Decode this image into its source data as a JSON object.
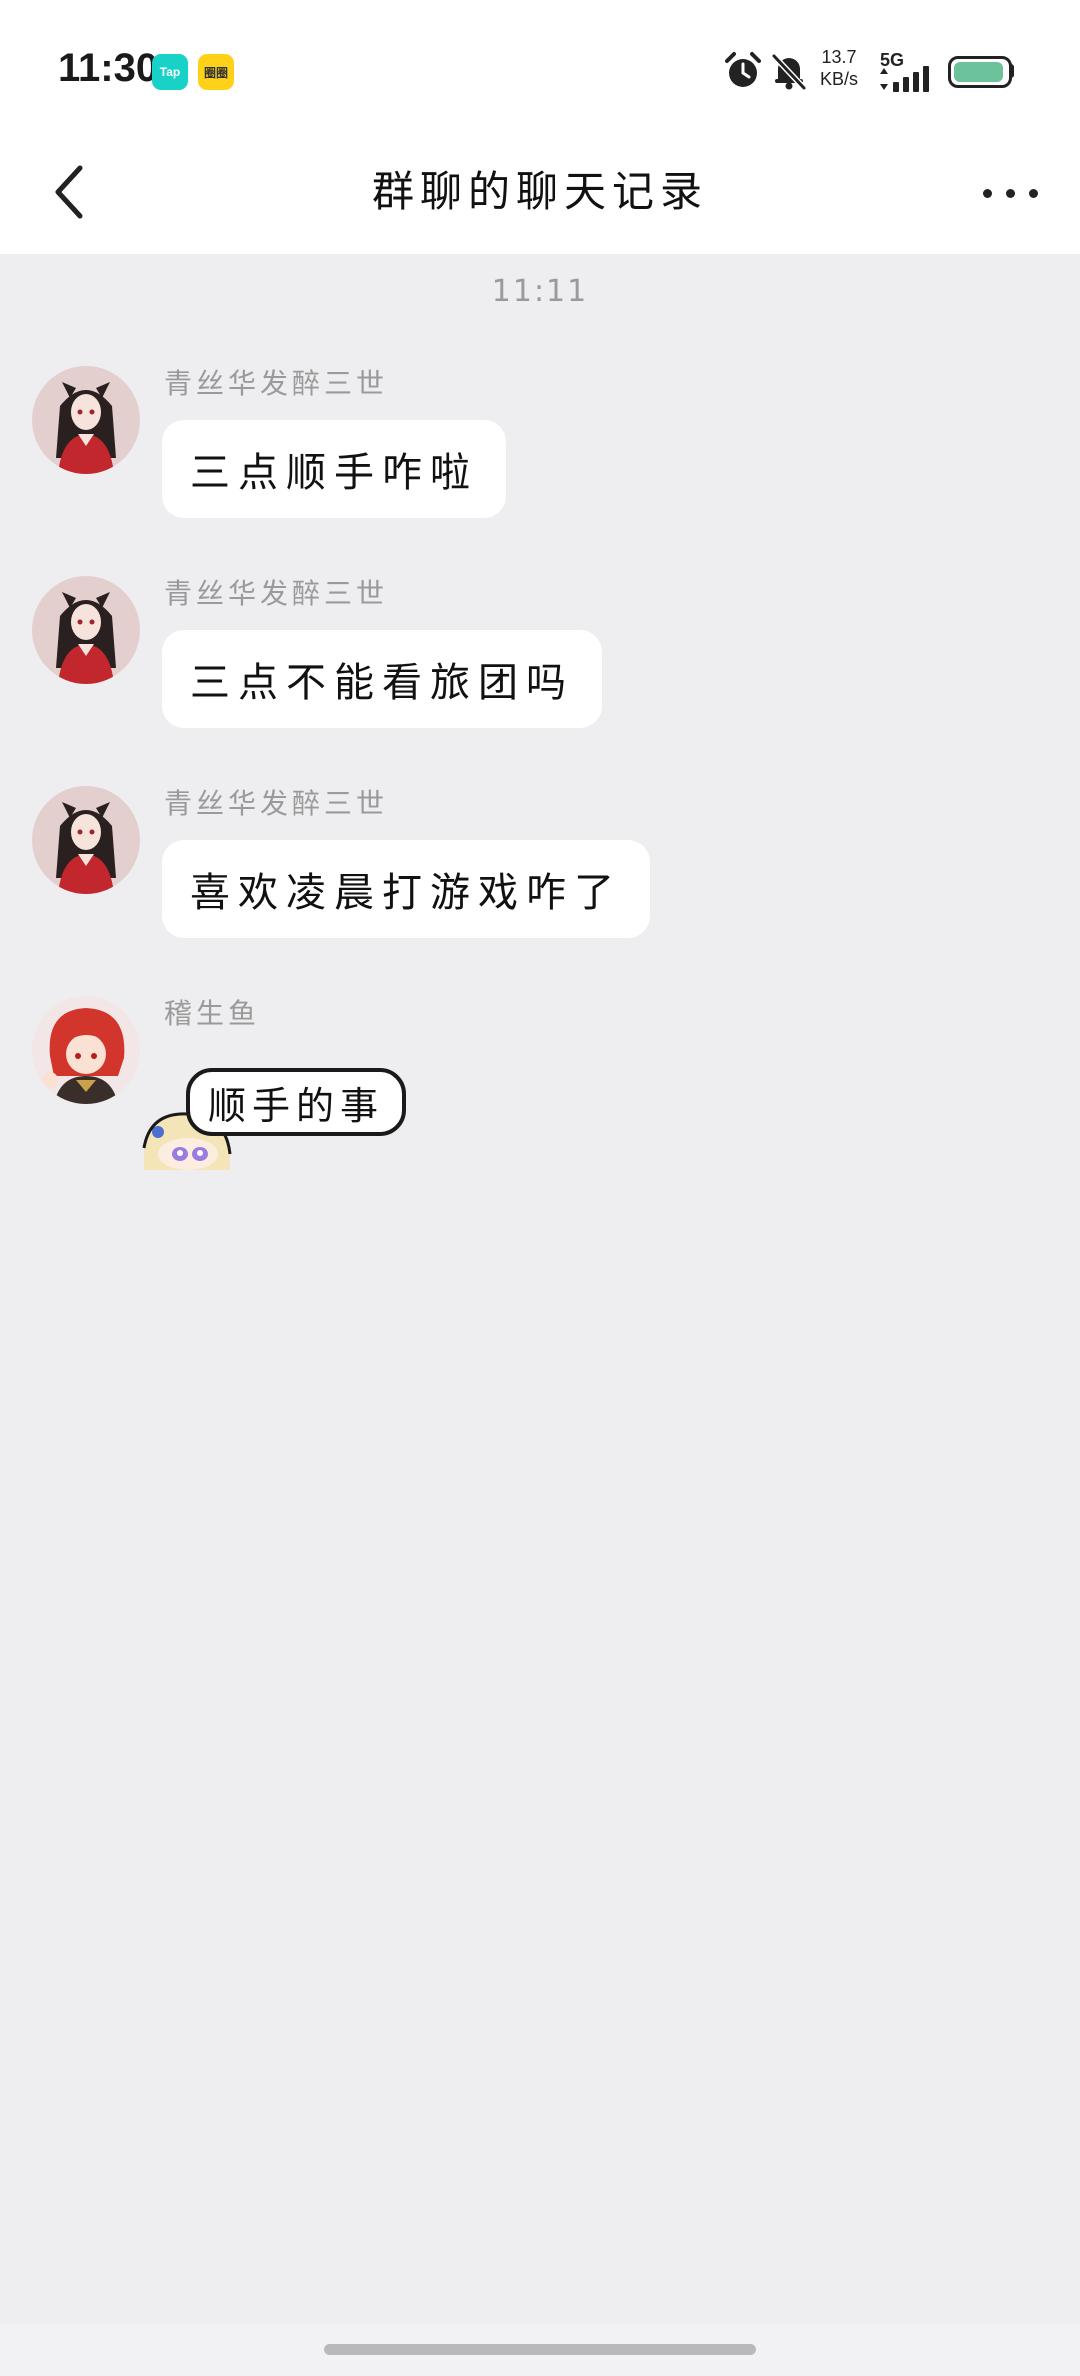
{
  "status_bar": {
    "time": "11:30",
    "badge_tap": "Tap",
    "badge_app2": "圈圈",
    "net_speed_value": "13.7",
    "net_speed_unit": "KB/s",
    "network_type": "5G",
    "battery_level": 0.95,
    "icons": [
      "alarm-icon",
      "bell-muted-icon",
      "signal-icon",
      "battery-icon"
    ]
  },
  "nav": {
    "title": "群聊的聊天记录",
    "back_icon": "chevron-left-icon",
    "more_icon": "more-dots-icon"
  },
  "chat": {
    "timestamp": "11:11",
    "messages": [
      {
        "sender": "青丝华发醉三世",
        "text": "三点顺手咋啦",
        "avatar": "avatar-girl-red-dress"
      },
      {
        "sender": "青丝华发醉三世",
        "text": "三点不能看旅团吗",
        "avatar": "avatar-girl-red-dress"
      },
      {
        "sender": "青丝华发醉三世",
        "text": "喜欢凌晨打游戏咋了",
        "avatar": "avatar-girl-red-dress"
      },
      {
        "sender": "稽生鱼",
        "sticker_text": "顺手的事",
        "avatar": "avatar-red-hair-boy",
        "type": "sticker"
      }
    ]
  },
  "colors": {
    "background": "#eeeef0",
    "bubble": "#ffffff",
    "secondary_text": "#9a9a9a",
    "battery": "#6cc29a"
  }
}
